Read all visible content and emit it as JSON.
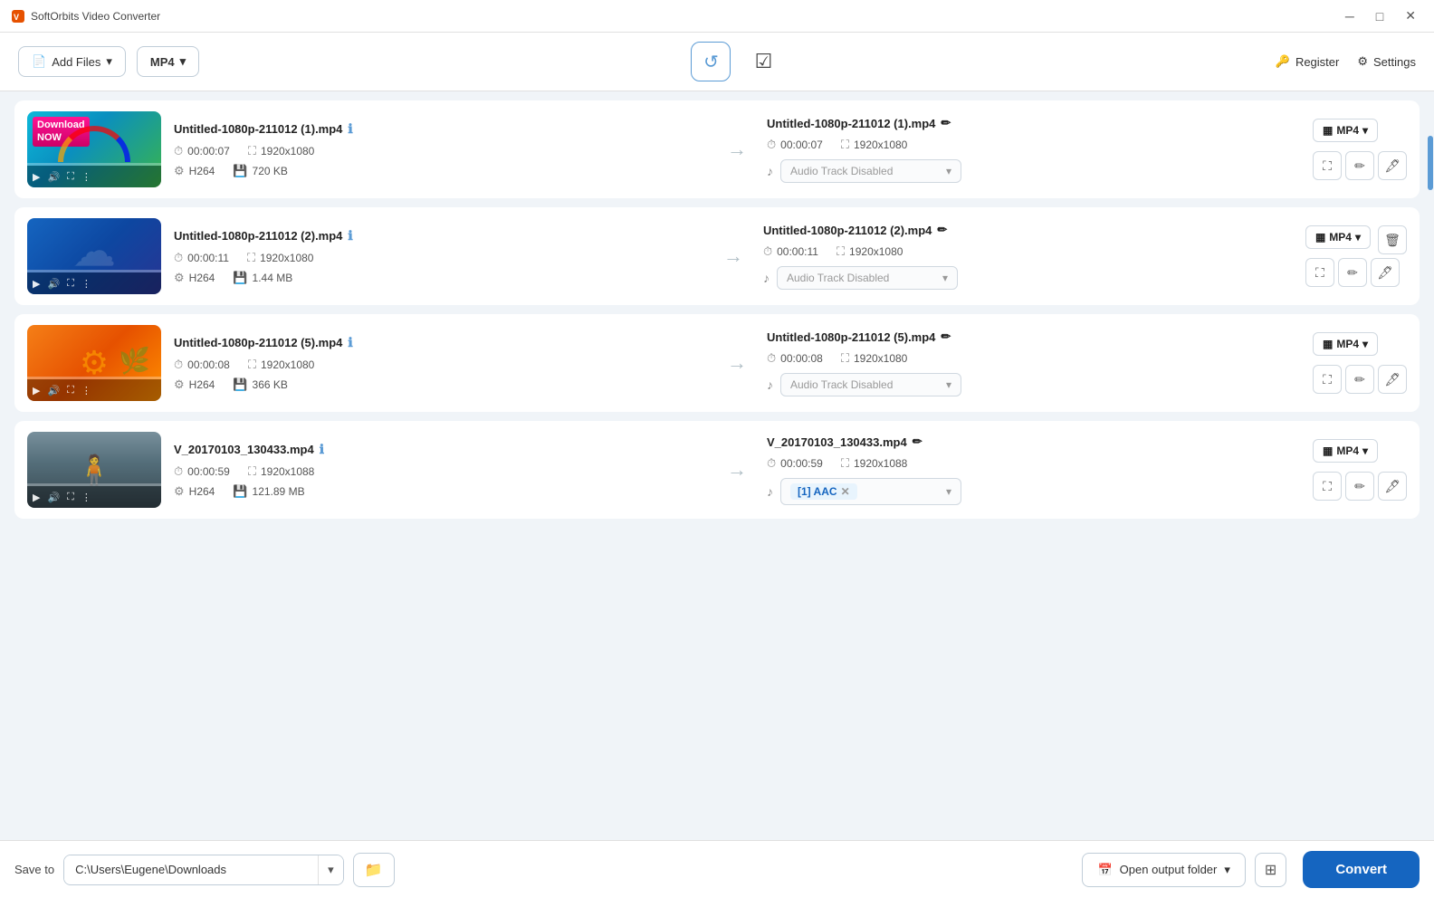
{
  "app": {
    "title": "SoftOrbits Video Converter",
    "min_label": "minimize",
    "max_label": "maximize",
    "close_label": "close"
  },
  "toolbar": {
    "add_files_label": "Add Files",
    "format_label": "MP4",
    "refresh_icon": "↺",
    "check_icon": "✔",
    "register_label": "Register",
    "settings_label": "Settings"
  },
  "files": [
    {
      "id": 1,
      "input_name": "Untitled-1080p-211012 (1).mp4",
      "input_duration": "00:00:07",
      "input_resolution": "1920x1080",
      "input_codec": "H264",
      "input_size": "720 KB",
      "output_name": "Untitled-1080p-211012 (1).mp4",
      "output_duration": "00:00:07",
      "output_resolution": "1920x1080",
      "output_format": "MP4",
      "audio_label": "Audio Track Disabled",
      "audio_type": "disabled",
      "thumb_type": "download"
    },
    {
      "id": 2,
      "input_name": "Untitled-1080p-211012 (2).mp4",
      "input_duration": "00:00:11",
      "input_resolution": "1920x1080",
      "input_codec": "H264",
      "input_size": "1.44 MB",
      "output_name": "Untitled-1080p-211012 (2).mp4",
      "output_duration": "00:00:11",
      "output_resolution": "1920x1080",
      "output_format": "MP4",
      "audio_label": "Audio Track Disabled",
      "audio_type": "disabled",
      "thumb_type": "blue"
    },
    {
      "id": 3,
      "input_name": "Untitled-1080p-211012 (5).mp4",
      "input_duration": "00:00:08",
      "input_resolution": "1920x1080",
      "input_codec": "H264",
      "input_size": "366 KB",
      "output_name": "Untitled-1080p-211012 (5).mp4",
      "output_duration": "00:00:08",
      "output_resolution": "1920x1080",
      "output_format": "MP4",
      "audio_label": "Audio Track Disabled",
      "audio_type": "disabled",
      "thumb_type": "orange"
    },
    {
      "id": 4,
      "input_name": "V_20170103_130433.mp4",
      "input_duration": "00:00:59",
      "input_resolution": "1920x1088",
      "input_codec": "H264",
      "input_size": "121.89 MB",
      "output_name": "V_20170103_130433.mp4",
      "output_duration": "00:00:59",
      "output_resolution": "1920x1088",
      "output_format": "MP4",
      "audio_label": "[1] AAC",
      "audio_type": "aac",
      "thumb_type": "forest"
    }
  ],
  "footer": {
    "save_to_label": "Save to",
    "save_to_path": "C:\\Users\\Eugene\\Downloads",
    "open_output_label": "Open output folder",
    "convert_label": "Convert"
  }
}
